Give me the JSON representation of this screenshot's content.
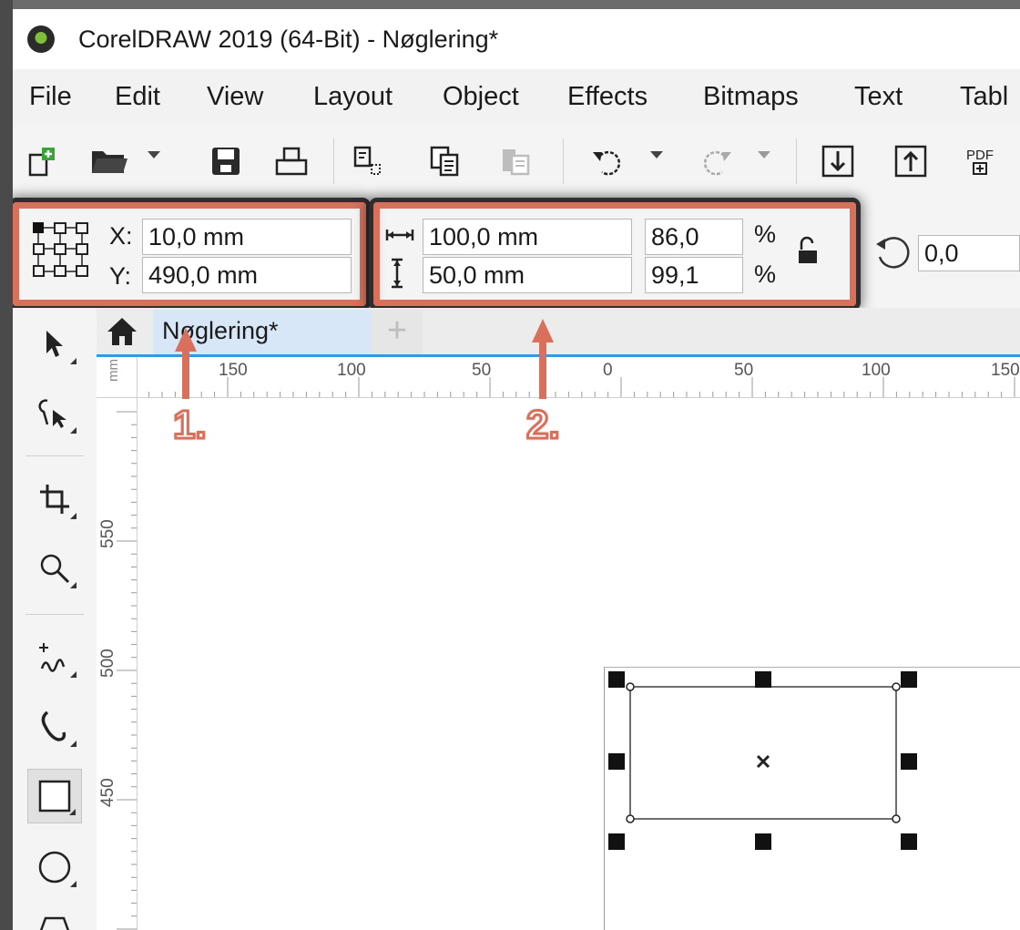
{
  "window": {
    "title": "CorelDRAW 2019 (64-Bit) - Nøglering*"
  },
  "menu": {
    "items": [
      "File",
      "Edit",
      "View",
      "Layout",
      "Object",
      "Effects",
      "Bitmaps",
      "Text",
      "Tabl"
    ]
  },
  "toolbar": {
    "icons": [
      "new-document-icon",
      "open-icon",
      "save-icon",
      "print-icon",
      "cut-icon",
      "copy-icon",
      "paste-icon",
      "undo-icon",
      "redo-icon",
      "import-icon",
      "export-icon",
      "publish-pdf-icon"
    ],
    "pdf_label": "PDF"
  },
  "property_bar": {
    "x_label": "X:",
    "x_value": "10,0 mm",
    "y_label": "Y:",
    "y_value": "490,0 mm",
    "width_value": "100,0 mm",
    "height_value": "50,0 mm",
    "scale_w": "86,0",
    "scale_h": "99,1",
    "percent_symbol": "%",
    "rotation_value": "0,0"
  },
  "document_tabs": {
    "active_tab": "Nøglering*",
    "add_tab": "+"
  },
  "ruler": {
    "top_labels": [
      "150",
      "100",
      "50",
      "0",
      "50",
      "100",
      "150"
    ],
    "left_labels": [
      "550",
      "500",
      "450"
    ],
    "units_corner": "mm"
  },
  "annotations": {
    "label_1": "1.",
    "label_2": "2.",
    "highlight_color": "#d9705c"
  },
  "tools": [
    "pick-tool",
    "shape-tool",
    "crop-tool",
    "zoom-tool",
    "freehand-tool",
    "artistic-media-tool",
    "rectangle-tool",
    "ellipse-tool",
    "polygon-tool"
  ]
}
